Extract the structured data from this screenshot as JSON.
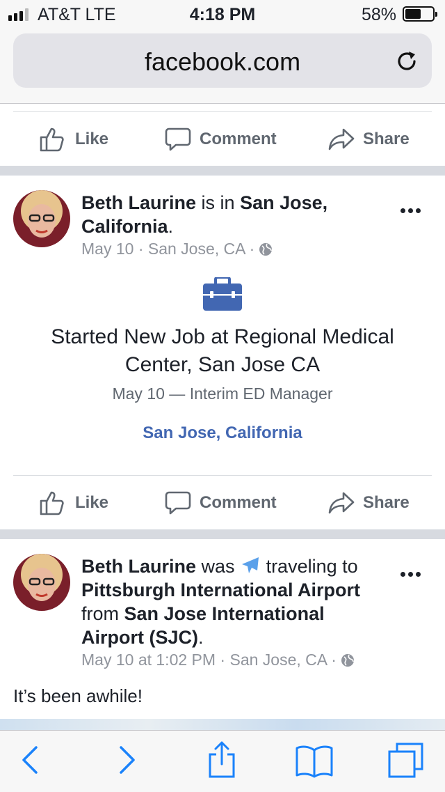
{
  "status": {
    "carrier": "AT&T  LTE",
    "time": "4:18 PM",
    "battery": "58%",
    "battery_level": 0.58
  },
  "browser": {
    "url": "facebook.com"
  },
  "actions": {
    "like": "Like",
    "comment": "Comment",
    "share": "Share"
  },
  "post1": {
    "author": "Beth Laurine",
    "headline_mid": " is in ",
    "place": "San Jose, California",
    "headline_end": ".",
    "meta": "May 10 · San Jose, CA ·",
    "event_title": "Started New Job at Regional Medical Center, San Jose CA",
    "event_sub": "May 10 — Interim ED Manager",
    "location_link": "San Jose, California"
  },
  "post2": {
    "author": "Beth Laurine",
    "was": " was ",
    "traveling": " traveling to ",
    "dest": "Pittsburgh International Airport",
    "from": " from ",
    "origin": "San Jose International Airport (SJC)",
    "end": ".",
    "meta": "May 10 at 1:02 PM · San Jose, CA ·",
    "text": "It’s been awhile!"
  },
  "icons": {
    "reload": "reload-icon",
    "like": "thumbs-up-icon",
    "comment": "comment-icon",
    "share": "share-arrow-icon",
    "globe": "globe-icon",
    "briefcase": "briefcase-icon",
    "plane": "airplane-icon",
    "back": "chevron-left-icon",
    "forward": "chevron-right-icon",
    "share_sheet": "share-sheet-icon",
    "bookmarks": "book-icon",
    "tabs": "tabs-icon"
  },
  "colors": {
    "facebook_blue": "#4267b2",
    "ios_blue": "#1a82fb",
    "meta_gray": "#90949c",
    "action_gray": "#606770"
  }
}
